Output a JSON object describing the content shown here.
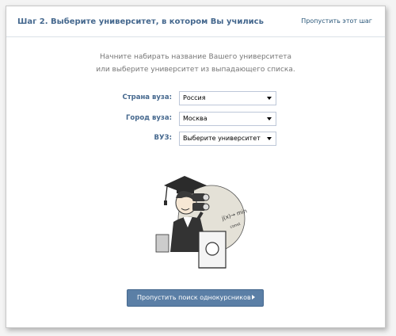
{
  "header": {
    "title": "Шаг 2. Выберите университет, в котором Вы учились",
    "skip_link": "Пропустить этот шаг"
  },
  "hint": {
    "line1": "Начните набирать название Вашего университета",
    "line2": "или выберите университет из выпадающего списка."
  },
  "form": {
    "country": {
      "label": "Страна вуза:",
      "value": "Россия"
    },
    "city": {
      "label": "Город вуза:",
      "value": "Москва"
    },
    "university": {
      "label": "ВУЗ:",
      "value": "Выберите университет"
    }
  },
  "illustration": {
    "icon": "graduate-with-binoculars",
    "formula_text": "f(x)→min",
    "formula_sub": "const"
  },
  "footer": {
    "skip_button": "Пропустить поиск однокурсников"
  },
  "colors": {
    "accent": "#45688e",
    "link": "#2b587a",
    "button": "#5b7fa6",
    "field_border": "#bdc7d8"
  }
}
